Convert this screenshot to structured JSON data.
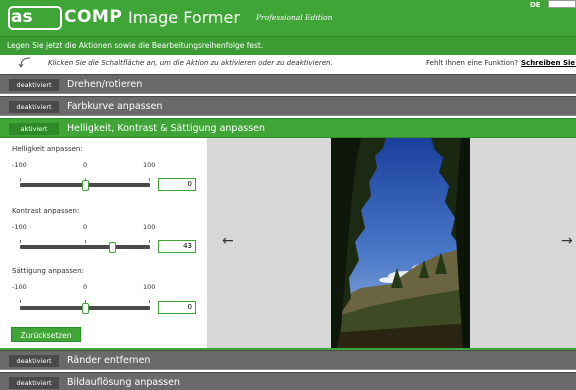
{
  "header": {
    "logo_a": "as",
    "logo_comp": "COMP",
    "title": "Image Former",
    "edition": "Professional Edition",
    "lang": "DE"
  },
  "instruction": "Legen Sie jetzt die Aktionen sowie die Bearbeitungsreihenfolge fest.",
  "hint": {
    "text": "Klicken Sie die Schaltfläche an, um die Aktion zu aktivieren oder zu deaktivieren.",
    "missing": "Fehlt Ihnen eine Funktion?",
    "link": "Schreiben Sie u"
  },
  "sections": [
    {
      "toggle": "deaktiviert",
      "title": "Drehen/rotieren",
      "active": false
    },
    {
      "toggle": "deaktiviert",
      "title": "Farbkurve anpassen",
      "active": false
    },
    {
      "toggle": "aktiviert",
      "title": "Helligkeit, Kontrast & Sättigung anpassen",
      "active": true
    },
    {
      "toggle": "deaktiviert",
      "title": "Ränder entfernen",
      "active": false
    },
    {
      "toggle": "deaktiviert",
      "title": "Bildauflösung anpassen",
      "active": false
    }
  ],
  "controls": {
    "brightness": {
      "label": "Helligkeit anpassen:",
      "min": "-100",
      "mid": "0",
      "max": "100",
      "value": "0",
      "level": 0
    },
    "contrast": {
      "label": "Kontrast anpassen:",
      "min": "-100",
      "mid": "0",
      "max": "100",
      "value": "43",
      "level": 43
    },
    "saturation": {
      "label": "Sättigung anpassen:",
      "min": "-100",
      "mid": "0",
      "max": "100",
      "value": "0",
      "level": 0
    },
    "reset": "Zurücksetzen"
  },
  "preview": {
    "prev_arrow": "←",
    "next_arrow": "→"
  },
  "colors": {
    "brand_green": "#3fa536",
    "section_gray": "#6a6a6a"
  }
}
